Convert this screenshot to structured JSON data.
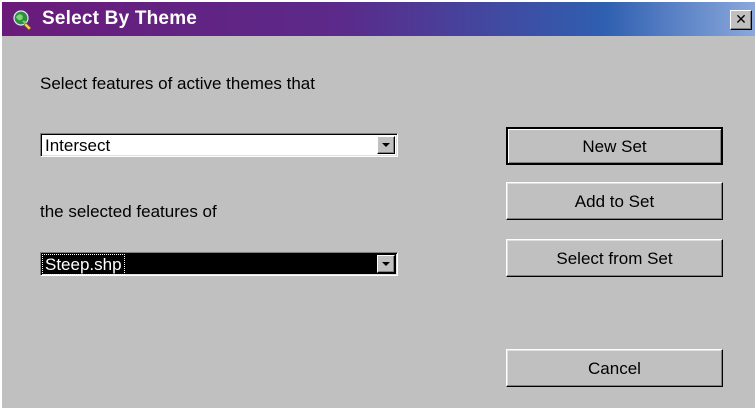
{
  "window": {
    "title": "Select By Theme",
    "close_glyph": "✕"
  },
  "icons": {
    "app": "globe-magnifier-icon",
    "close": "close-icon",
    "dropdown": "chevron-down-icon"
  },
  "form": {
    "prompt_label": "Select features of active themes that",
    "relation_value": "Intersect",
    "target_label": "the selected features of",
    "theme_value": "Steep.shp"
  },
  "buttons": {
    "new_set": "New Set",
    "add_to_set": "Add to Set",
    "select_from_set": "Select from Set",
    "cancel": "Cancel"
  },
  "colors": {
    "titlebar_start": "#6a1b7a",
    "titlebar_end": "#8aa8dc",
    "face": "#c0c0c0"
  }
}
